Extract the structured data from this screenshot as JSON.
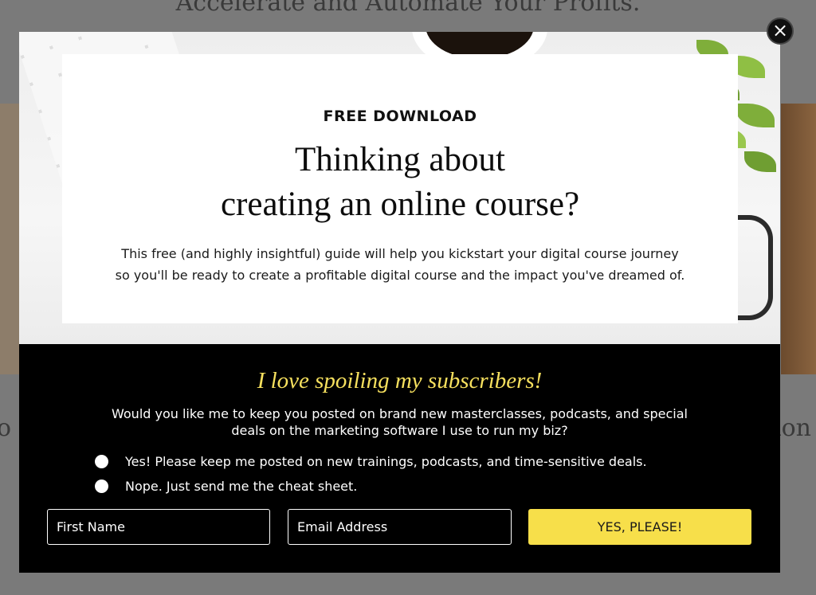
{
  "background": {
    "heading": "Accelerate and Automate Your Profits.",
    "left_text": "o",
    "right_text": "ion"
  },
  "modal": {
    "close_icon": "×",
    "eyebrow": "FREE DOWNLOAD",
    "headline_line1": "Thinking about",
    "headline_line2": "creating an online course?",
    "subtext_line1": "This free (and highly insightful) guide will help you kickstart your digital course journey",
    "subtext_line2": "so you'll be ready to create a profitable digital course and the impact you've dreamed of.",
    "spoil_heading": "I love spoiling my subscribers!",
    "question_line1": "Would you like me to keep you posted on brand new masterclasses, podcasts, and special",
    "question_line2": "deals on the marketing software I use to run my biz?",
    "options": [
      {
        "label": "Yes! Please keep me posted on new trainings, podcasts, and time-sensitive deals."
      },
      {
        "label": "Nope. Just send me the cheat sheet."
      }
    ],
    "form": {
      "first_name_placeholder": "First Name",
      "email_placeholder": "Email Address",
      "submit_label": "YES, PLEASE!"
    }
  },
  "colors": {
    "accent_yellow": "#f7df4a",
    "heading_yellow": "#f6e05e",
    "panel_black": "#000000"
  }
}
